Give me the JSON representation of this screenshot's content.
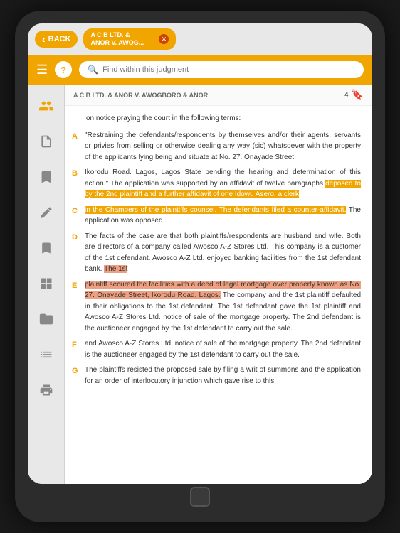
{
  "topBar": {
    "back_label": "BACK",
    "tab_title_line1": "A C B LTD. &",
    "tab_title_line2": "ANOR V. AWOG...",
    "close_icon": "✕"
  },
  "toolbar": {
    "menu_icon": "☰",
    "help_icon": "?",
    "search_placeholder": "Find within this judgment"
  },
  "sidebar": {
    "icons": [
      {
        "name": "people-icon",
        "symbol": "👤",
        "active": true
      },
      {
        "name": "document-icon",
        "symbol": "☰",
        "active": false
      },
      {
        "name": "scale-icon",
        "symbol": "⚖",
        "active": false
      },
      {
        "name": "pencil-icon",
        "symbol": "✏",
        "active": false
      },
      {
        "name": "bookmark-icon",
        "symbol": "🔖",
        "active": false
      },
      {
        "name": "grid-icon",
        "symbol": "⊞",
        "active": false
      },
      {
        "name": "folder-icon",
        "symbol": "📁",
        "active": false
      },
      {
        "name": "list-icon",
        "symbol": "☰",
        "active": false
      },
      {
        "name": "print-icon",
        "symbol": "🖨",
        "active": false
      }
    ]
  },
  "document": {
    "case_title": "A C B LTD. & ANOR V. AWOGBORO & ANOR",
    "page_number": "4",
    "bookmark_icon": "🔖",
    "intro_text": "on notice praying the court in the following terms:",
    "paragraphs": [
      {
        "label": "A",
        "text_parts": [
          {
            "text": "\"Restraining the defendants/respondents by themselves and/or their agents. servants or privies from selling or otherwise dealing any way (sic) whatsoever with the property of the applicants lying being and situate at No. 27. Onayade Street,",
            "highlight": "none"
          }
        ]
      },
      {
        "label": "B",
        "text_parts": [
          {
            "text": "Ikorodu Road. Lagos, Lagos State pending the hearing and determination of this action.\" The application was supported by an affidavit of twelve paragraphs ",
            "highlight": "none"
          },
          {
            "text": "deposed to by the 2nd plaintiff and a further affidavit of one Idowu Asero, a clerk",
            "highlight": "orange"
          }
        ]
      },
      {
        "label": "C",
        "text_parts": [
          {
            "text": "in the Chambers of the plaintiffs counsel. The defendants filed a counter-affidavit.",
            "highlight": "orange"
          },
          {
            "text": " The application was opposed.",
            "highlight": "none"
          }
        ]
      },
      {
        "label": "D",
        "text_parts": [
          {
            "text": "The facts of the case are that both plaintiffs/respondents are husband and wife. Both are directors of a company called Awosco A-Z Stores Ltd. This company is a customer of the 1st defendant. Awosco A-Z Ltd. enjoyed banking facilities from the 1st defendant bank. ",
            "highlight": "none"
          },
          {
            "text": "The 1st",
            "highlight": "none"
          }
        ]
      },
      {
        "label": "E",
        "text_parts": [
          {
            "text": "plaintiff secured the facilities with a deed of legal mortgage over property known as No. 27. Onayade Street, Ikorodu Road. Lagos.",
            "highlight": "pink"
          },
          {
            "text": " The company and the 1st plaintiff defaulted in their obligations to the 1st defendant. The 1st defendant gave the 1st plaintiff and Awosco A-Z Stores Ltd. notice of sale of the mortgage property. The 2nd defendant is the auctioneer engaged by the 1st defendant to carry out the sale.",
            "highlight": "none"
          }
        ]
      },
      {
        "label": "F",
        "text_parts": [
          {
            "text": "The plaintiffs resisted the proposed sale by filing a writ of summons and the application for an order of interlocutory injunction which gave rise to this",
            "highlight": "none"
          }
        ]
      },
      {
        "label": "G",
        "text_parts": [
          {
            "text": "The plaintiffs resisted the proposed sale by filing a writ of summons and the application for an order of interlocutory injunction which gave rise to this",
            "highlight": "none"
          }
        ]
      }
    ]
  }
}
